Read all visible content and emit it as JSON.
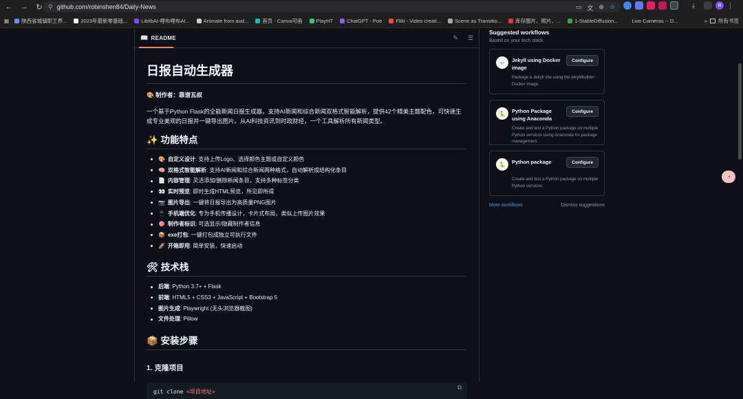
{
  "browser": {
    "url_host": "github.com",
    "url_path": "/robinshen84/Daily-News",
    "bookmarks": [
      {
        "label": "陕西省城镇职工养...",
        "color": "#6b8cff"
      },
      {
        "label": "2023年最新零基础...",
        "color": "#ffffff"
      },
      {
        "label": "LiblibAI-哩布哩布AI...",
        "color": "#7c4dff"
      },
      {
        "label": "Animate from aud...",
        "color": "#cccccc"
      },
      {
        "label": "首页 - Canva可画",
        "color": "#00c4cc"
      },
      {
        "label": "PlayHT",
        "color": "#2ecc71"
      },
      {
        "label": "ChatGPT - Poe",
        "color": "#8b5cf6"
      },
      {
        "label": "Fliki - Video creati...",
        "color": "#e74c3c"
      },
      {
        "label": "Scene as Transitio...",
        "color": "#aaaaaa"
      },
      {
        "label": "库存图片、照片、...",
        "color": "#e53935"
      },
      {
        "label": "1-StableDiffusion...",
        "color": "#43a047"
      },
      {
        "label": "Live Cameras -- D...",
        "color": "#1f1f1f"
      }
    ],
    "bookmarks_more": "»",
    "all_bookmarks": "所有书签",
    "avatar_letter": "R"
  },
  "readme": {
    "tab_label": "README",
    "title": "日报自动生成器",
    "author_emoji": "🎨",
    "author": "制作者：靠谱瓦叔",
    "description": "一个基于Python Flask的全能新闻日报生成器，支持AI新闻和综合新闻双格式智能解析，提供42个精美主题配色，可快速生成专业美观的日报并一键导出图片。从AI科技资讯到时政财经，一个工具解析所有新闻类型。",
    "features_heading": "✨ 功能特点",
    "features": [
      {
        "emoji": "🎨",
        "bold": "自定义设计",
        "text": ": 支持上传Logo、选择颜色主题或自定义颜色"
      },
      {
        "emoji": "🧠",
        "bold": "双格式智能解析",
        "text": ": 支持AI新闻和综合新闻两种格式，自动解析成结构化条目"
      },
      {
        "emoji": "📄",
        "bold": "内容管理",
        "text": ": 灵活添加/删除新闻条目，支持多种标签分类"
      },
      {
        "emoji": "👀",
        "bold": "实时预览",
        "text": ": 即时生成HTML预览，所见即所得"
      },
      {
        "emoji": "📷",
        "bold": "图片导出",
        "text": ": 一键将日报导出为高质量PNG图片"
      },
      {
        "emoji": "📱",
        "bold": "手机端优化",
        "text": ": 专为手机传播设计，卡片式布局，类似上传图片效果"
      },
      {
        "emoji": "🎯",
        "bold": "制作者标识",
        "text": ": 可选显示/隐藏制作者信息"
      },
      {
        "emoji": "📦",
        "bold": "exe打包",
        "text": ": 一键打包成独立可执行文件"
      },
      {
        "emoji": "🚀",
        "bold": "开箱即用",
        "text": ": 简单安装，快速启动"
      }
    ],
    "tech_heading": "🛠 技术栈",
    "tech": [
      {
        "bold": "后端",
        "text": ": Python 3.7+ + Flask"
      },
      {
        "bold": "前端",
        "text": ": HTML5 + CSS3 + JavaScript + Bootstrap 5"
      },
      {
        "bold": "图片生成",
        "text": ": Playwright (无头浏览器截图)"
      },
      {
        "bold": "文件处理",
        "text": ": Pillow"
      }
    ],
    "install_heading": "📦 安装步骤",
    "step1_heading": "1. 克隆项目",
    "code_cmd": "git clone ",
    "code_arg": "<项目地址>"
  },
  "sidebar": {
    "title": "Suggested workflows",
    "subtitle": "Based on your tech stack",
    "workflows": [
      {
        "name": "Jekyll using Docker image",
        "button": "Configure",
        "desc": "Package a Jekyll site using the jekyll/builder Docker image."
      },
      {
        "name": "Python Package using Anaconda",
        "button": "Configure",
        "desc": "Create and test a Python package on multiple Python versions using Anaconda for package management."
      },
      {
        "name": "Python package",
        "button": "Configure",
        "desc": "Create and test a Python package on multiple Python versions."
      }
    ],
    "more": "More workflows",
    "dismiss": "Dismiss suggestions"
  }
}
